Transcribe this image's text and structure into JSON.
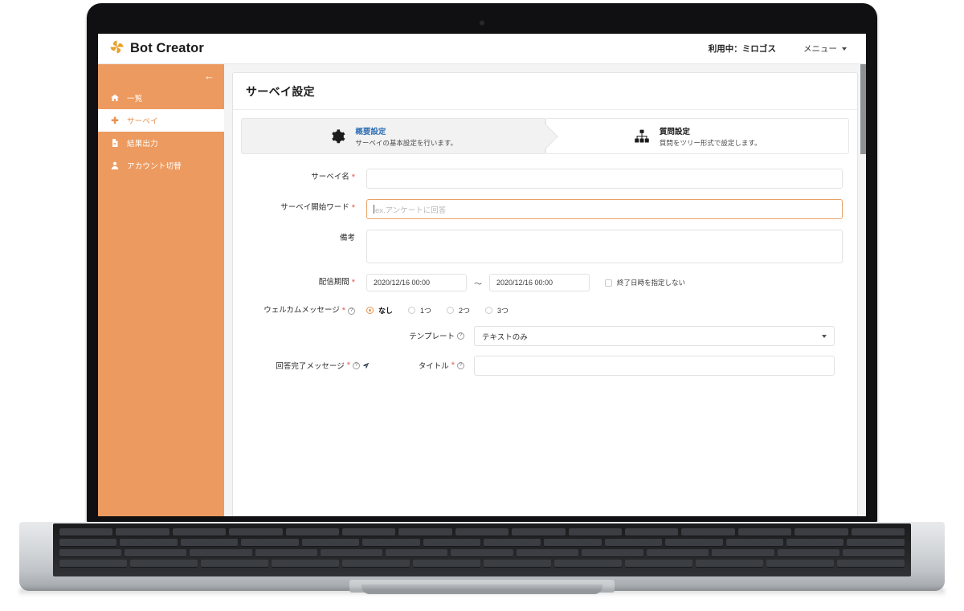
{
  "device": {
    "model_label": "MacBook Air"
  },
  "topbar": {
    "brand": "Bot Creator",
    "logo_icon": "pinwheel-logo-icon",
    "tenant": "利用中：ミロゴス",
    "menu_label": "メニュー",
    "accent_color": "#ec9a5f"
  },
  "sidebar": {
    "collapse_icon": "←",
    "items": [
      {
        "label": "一覧",
        "icon": "home-icon",
        "active": false
      },
      {
        "label": "サーベイ",
        "icon": "plus-icon",
        "active": true
      },
      {
        "label": "結果出力",
        "icon": "file-export-icon",
        "active": false
      },
      {
        "label": "アカウント切替",
        "icon": "user-icon",
        "active": false
      }
    ]
  },
  "page": {
    "title": "サーベイ設定"
  },
  "steps": [
    {
      "title": "概要設定",
      "subtitle": "サーベイの基本設定を行います。",
      "icon": "gear-icon",
      "active": true
    },
    {
      "title": "質問設定",
      "subtitle": "質問をツリー形式で設定します。",
      "icon": "sitemap-icon",
      "active": false
    }
  ],
  "form": {
    "survey_name": {
      "label": "サーベイ名",
      "required": true,
      "value": "",
      "placeholder": ""
    },
    "start_word": {
      "label": "サーベイ開始ワード",
      "required": true,
      "value": "",
      "placeholder": "ex.アンケートに回答",
      "focused": true
    },
    "remarks": {
      "label": "備考",
      "required": false,
      "value": ""
    },
    "delivery_period": {
      "label": "配信期間",
      "required": true,
      "start": "2020/12/16 00:00",
      "separator": "～",
      "end": "2020/12/16 00:00",
      "no_end_checkbox": {
        "label": "終了日時を指定しない",
        "checked": false
      }
    },
    "welcome_message": {
      "label": "ウェルカムメッセージ",
      "required": true,
      "help": "?",
      "options": [
        {
          "label": "なし",
          "selected": true
        },
        {
          "label": "1つ",
          "selected": false
        },
        {
          "label": "2つ",
          "selected": false
        },
        {
          "label": "3つ",
          "selected": false
        }
      ]
    },
    "completion_message": {
      "label": "回答完了メッセージ",
      "required": true,
      "help": "?",
      "send_icon": "paper-plane-icon",
      "template": {
        "label": "テンプレート",
        "help": "?",
        "value": "テキストのみ"
      },
      "title_field": {
        "label": "タイトル",
        "required": true,
        "help": "?",
        "value": ""
      }
    }
  }
}
